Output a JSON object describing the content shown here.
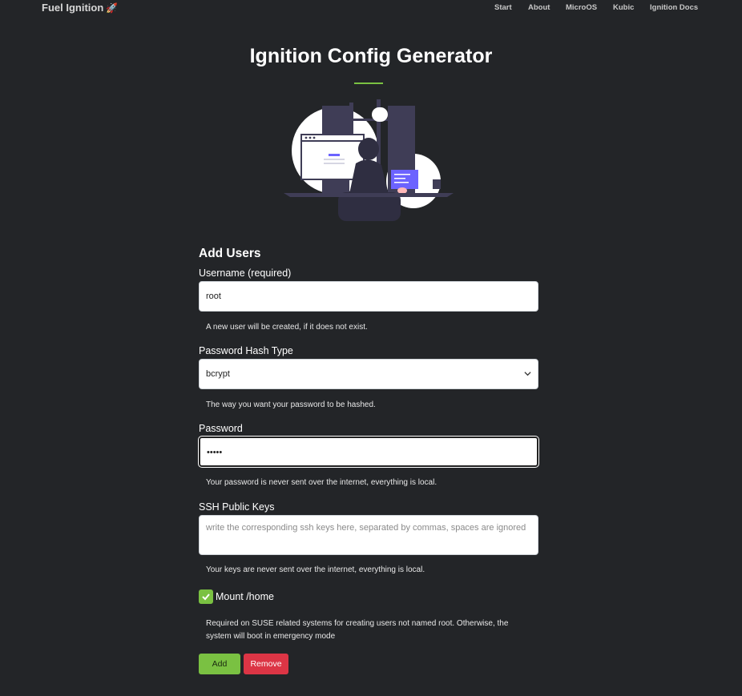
{
  "brand": {
    "name": "Fuel Ignition",
    "emoji": "🚀"
  },
  "nav": [
    {
      "label": "Start"
    },
    {
      "label": "About"
    },
    {
      "label": "MicroOS"
    },
    {
      "label": "Kubic"
    },
    {
      "label": "Ignition Docs"
    }
  ],
  "page": {
    "title": "Ignition Config Generator"
  },
  "form": {
    "heading": "Add Users",
    "username": {
      "label": "Username (required)",
      "value": "root",
      "help": "A new user will be created, if it does not exist."
    },
    "hash_type": {
      "label": "Password Hash Type",
      "selected": "bcrypt",
      "help": "The way you want your password to be hashed."
    },
    "password": {
      "label": "Password",
      "value": "•••••",
      "help": "Your password is never sent over the internet, everything is local."
    },
    "ssh_keys": {
      "label": "SSH Public Keys",
      "placeholder": "write the corresponding ssh keys here, separated by commas, spaces are ignored",
      "help": "Your keys are never sent over the internet, everything is local."
    },
    "mount_home": {
      "label": "Mount /home",
      "checked": true,
      "help": "Required on SUSE related systems for creating users not named root. Otherwise, the system will boot in emergency mode"
    },
    "add_label": "Add",
    "remove_label": "Remove"
  },
  "colors": {
    "background": "#232528",
    "accent": "#7ac142",
    "danger": "#dc3545"
  }
}
